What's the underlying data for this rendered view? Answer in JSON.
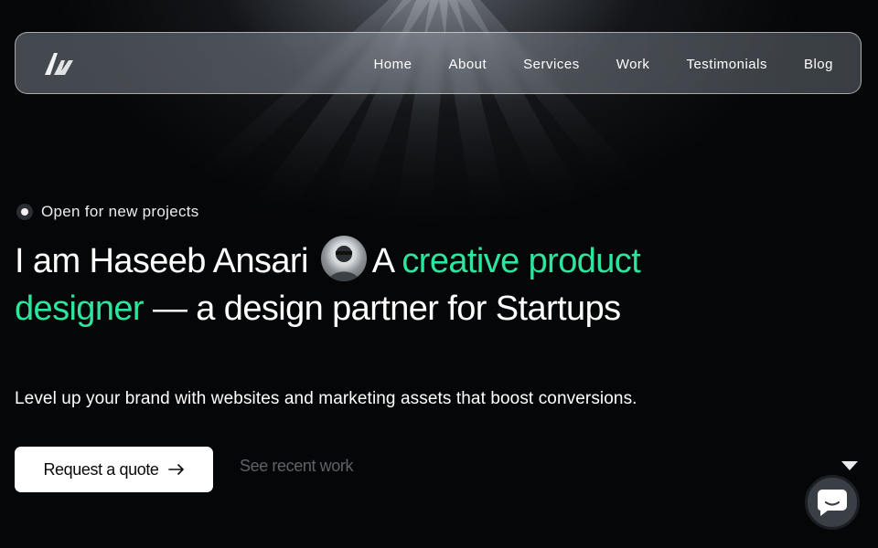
{
  "nav": {
    "logo_name": "logo-icon",
    "links": [
      {
        "label": "Home"
      },
      {
        "label": "About"
      },
      {
        "label": "Services"
      },
      {
        "label": "Work"
      },
      {
        "label": "Testimonials"
      },
      {
        "label": "Blog"
      }
    ]
  },
  "hero": {
    "status": "Open for new projects",
    "headline": {
      "part1": "I am Haseeb Ansari",
      "part2": "A",
      "accent": "creative product designer",
      "part3": "— a design partner for Startups"
    },
    "subtitle": "Level up your brand with websites and marketing assets that boost conversions.",
    "primary_cta": "Request a quote",
    "secondary_cta": "See recent work"
  },
  "colors": {
    "accent": "#2ee59d",
    "background": "#050607",
    "button_bg": "#ffffff"
  },
  "icons": {
    "primary_cta": "arrow-right-icon",
    "chat": "chat-bubble-icon",
    "caret": "caret-down-icon"
  }
}
